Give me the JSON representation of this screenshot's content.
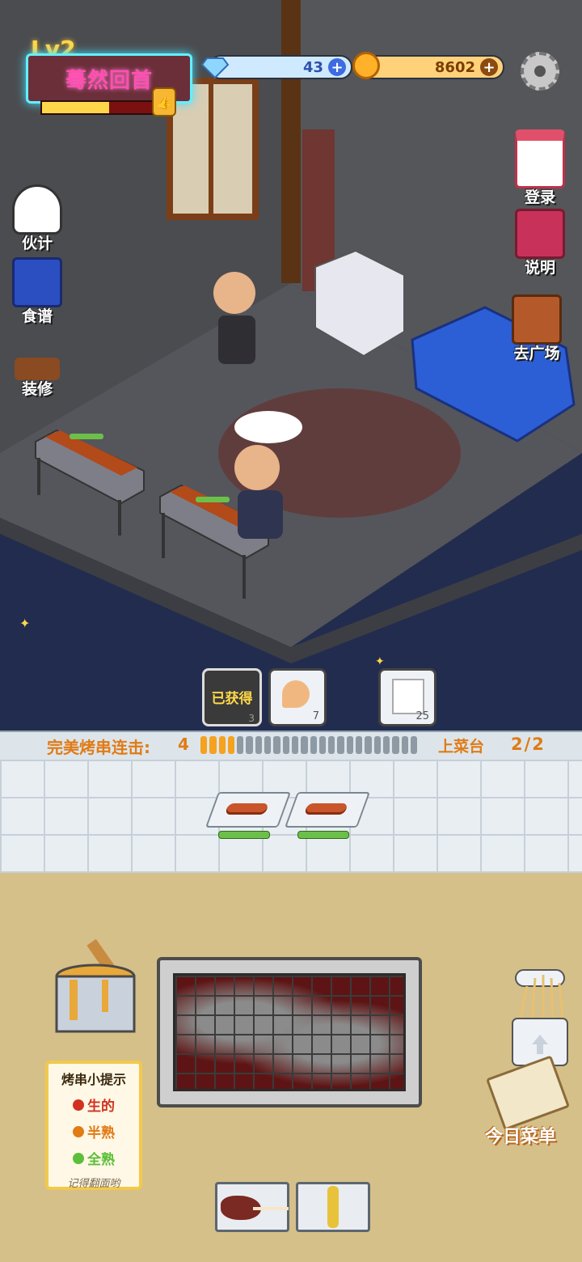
{
  "hud": {
    "level": "Lv2",
    "level_progress": 0.55,
    "title": "蓦然回首",
    "gems": "43",
    "coins": "8602"
  },
  "side_left": [
    {
      "label": "伙计",
      "icon": "chef-icon"
    },
    {
      "label": "食谱",
      "icon": "recipe-book-icon"
    },
    {
      "label": "装修",
      "icon": "decor-table-icon"
    }
  ],
  "side_right": [
    {
      "label": "登录",
      "icon": "calendar-icon"
    },
    {
      "label": "说明",
      "icon": "manual-book-icon"
    },
    {
      "label": "去广场",
      "icon": "door-icon"
    }
  ],
  "orders": [
    {
      "label": "已获得",
      "count": "3"
    },
    {
      "count": "7"
    },
    {
      "count": "25"
    }
  ],
  "combo": {
    "label": "完美烤串连击:",
    "value": "4",
    "filled": 4,
    "total": 24
  },
  "serve": {
    "label": "上菜台",
    "count": "2/2"
  },
  "tips": {
    "title": "烤串小提示",
    "items": [
      {
        "label": "生的",
        "color": "#d1321f"
      },
      {
        "label": "半熟",
        "color": "#e07b16"
      },
      {
        "label": "全熟",
        "color": "#5bbf3a"
      }
    ],
    "note": "记得翻面哟"
  },
  "today_menu": "今日菜单",
  "colors": {
    "accent": "#e07b16",
    "neon_pink": "#ff4fb0",
    "neon_cyan": "#62f0ff"
  }
}
